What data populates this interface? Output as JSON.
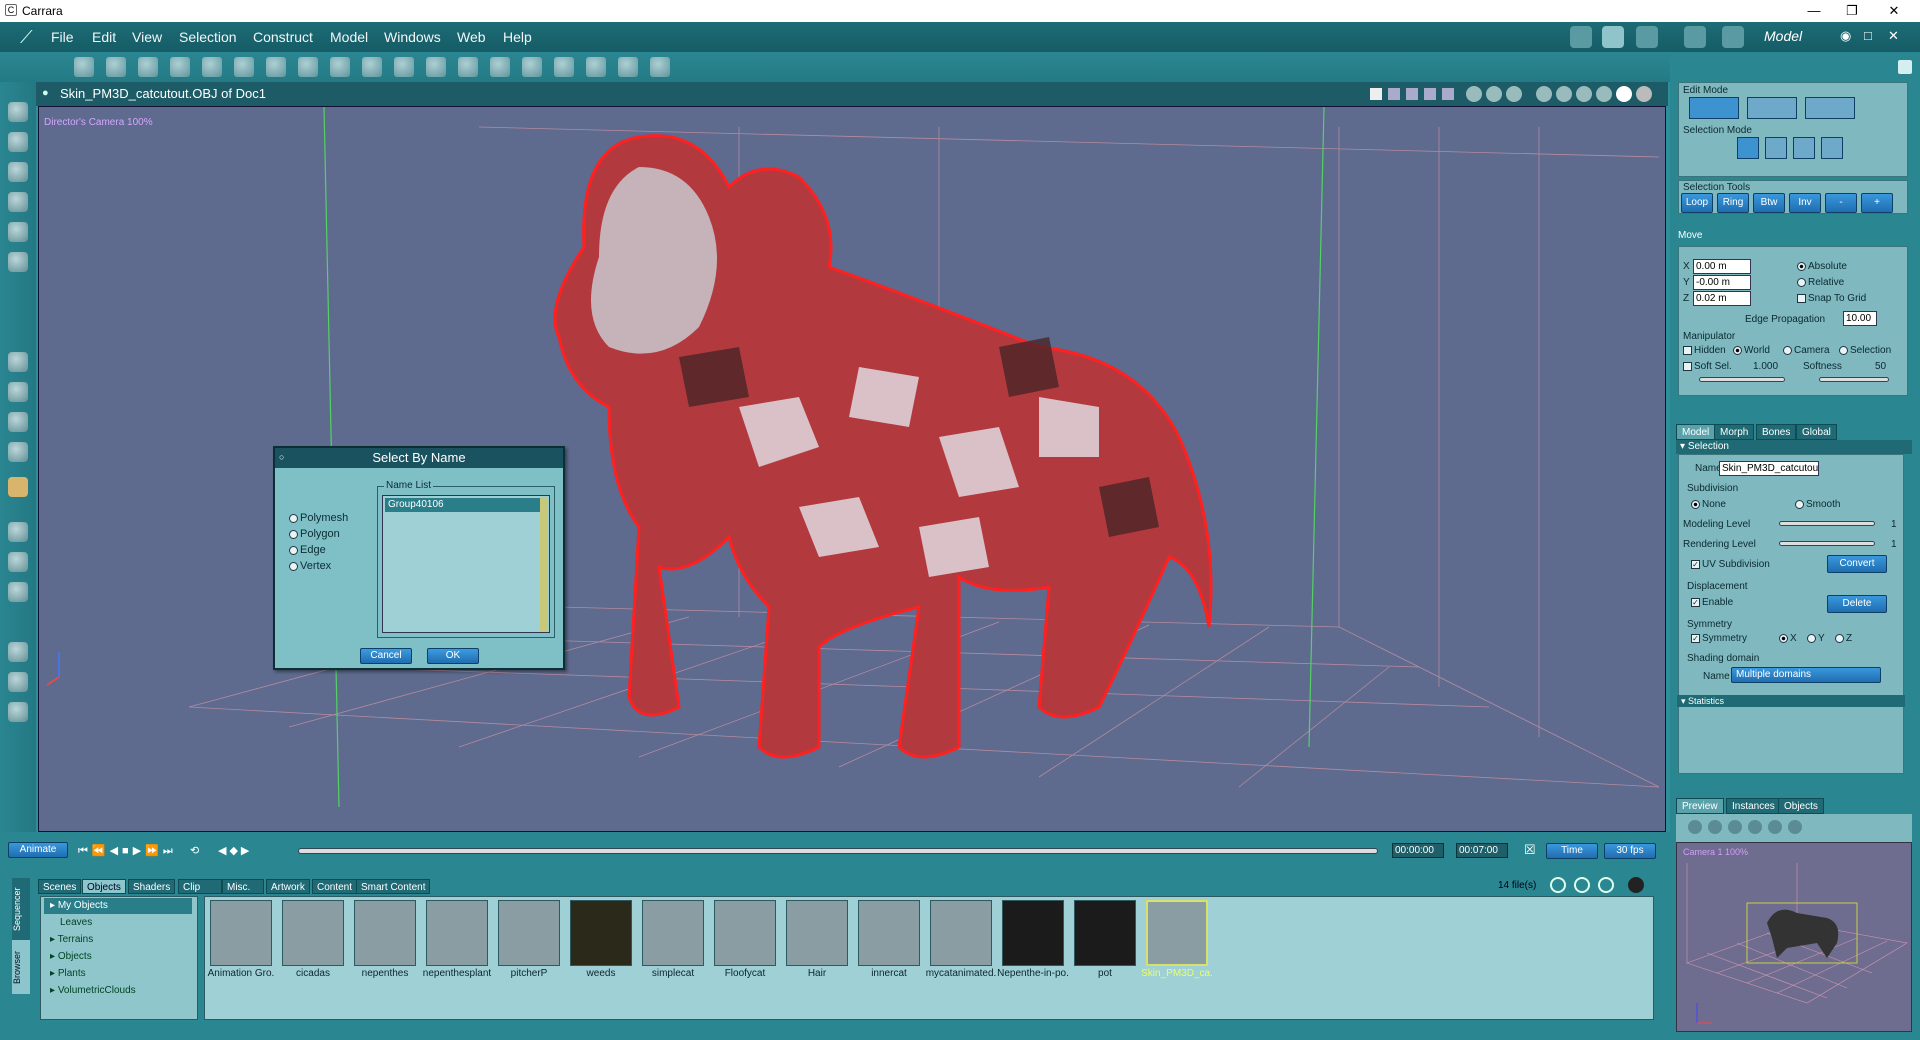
{
  "window": {
    "title": "Carrara"
  },
  "menu": [
    "File",
    "Edit",
    "View",
    "Selection",
    "Construct",
    "Model",
    "Windows",
    "Web",
    "Help"
  ],
  "room_label": "Model",
  "viewport": {
    "title": "Skin_PM3D_catcutout.OBJ of Doc1",
    "camera": "Director's Camera 100%"
  },
  "dialog": {
    "title": "Select By Name",
    "modes": [
      "Polymesh",
      "Polygon",
      "Edge",
      "Vertex"
    ],
    "list_label": "Name List",
    "items": [
      "Group40106"
    ],
    "cancel": "Cancel",
    "ok": "OK"
  },
  "right": {
    "edit_mode": "Edit Mode",
    "selection_mode": "Selection Mode",
    "selection_tools": "Selection Tools",
    "tools": [
      "Loop",
      "Ring",
      "Btw",
      "Inv",
      "-",
      "+"
    ],
    "move": "Move",
    "x": "0.00 m",
    "y": "-0.00 m",
    "z": "0.02 m",
    "x_lbl": "X",
    "y_lbl": "Y",
    "z_lbl": "Z",
    "absolute": "Absolute",
    "relative": "Relative",
    "snap": "Snap To Grid",
    "edge_prop_lbl": "Edge Propagation",
    "edge_prop": "10.00",
    "manipulator": "Manipulator",
    "hidden": "Hidden",
    "world": "World",
    "camera": "Camera",
    "selection": "Selection",
    "soft_sel": "Soft Sel.",
    "soft_val": "1.000",
    "softness": "Softness",
    "softness_val": "50",
    "tabs": [
      "Model",
      "Morph",
      "Bones",
      "Global"
    ],
    "section": "Selection",
    "name_lbl": "Name",
    "name": "Skin_PM3D_catcutou",
    "subdivision": "Subdivision",
    "none": "None",
    "smooth": "Smooth",
    "modeling_level": "Modeling Level",
    "rendering_level": "Rendering Level",
    "level_val": "1",
    "uv_sub": "UV Subdivision",
    "convert": "Convert",
    "displacement": "Displacement",
    "enable": "Enable",
    "delete": "Delete",
    "symmetry": "Symmetry",
    "sym_chk": "Symmetry",
    "sx": "X",
    "sy": "Y",
    "sz": "Z",
    "shading": "Shading domain",
    "shading_name_lbl": "Name",
    "shading_name": "Multiple domains",
    "statistics": "Statistics",
    "preview_tabs": [
      "Preview",
      "Instances",
      "Objects"
    ],
    "preview_cam": "Camera 1 100%"
  },
  "timeline": {
    "animate": "Animate",
    "start": "00:00:00",
    "end": "00:07:00",
    "time": "Time",
    "fps": "30 fps"
  },
  "browser": {
    "tabs": [
      "Scenes",
      "Objects",
      "Shaders",
      "Clip",
      "Misc.",
      "Artwork",
      "Content",
      "Smart Content"
    ],
    "side_tabs": [
      "Sequencer",
      "Browser"
    ],
    "files": "14 file(s)",
    "tree": [
      "My Objects",
      "Leaves",
      "Terrains",
      "Objects",
      "Plants",
      "VolumetricClouds"
    ],
    "items": [
      "Animation Gro.",
      "cicadas",
      "nepenthes",
      "nepenthesplant",
      "pitcherP",
      "weeds",
      "simplecat",
      "Floofycat",
      "Hair",
      "innercat",
      "mycatanimated.",
      "Nepenthe-in-po.",
      "pot",
      "Skin_PM3D_ca."
    ]
  }
}
